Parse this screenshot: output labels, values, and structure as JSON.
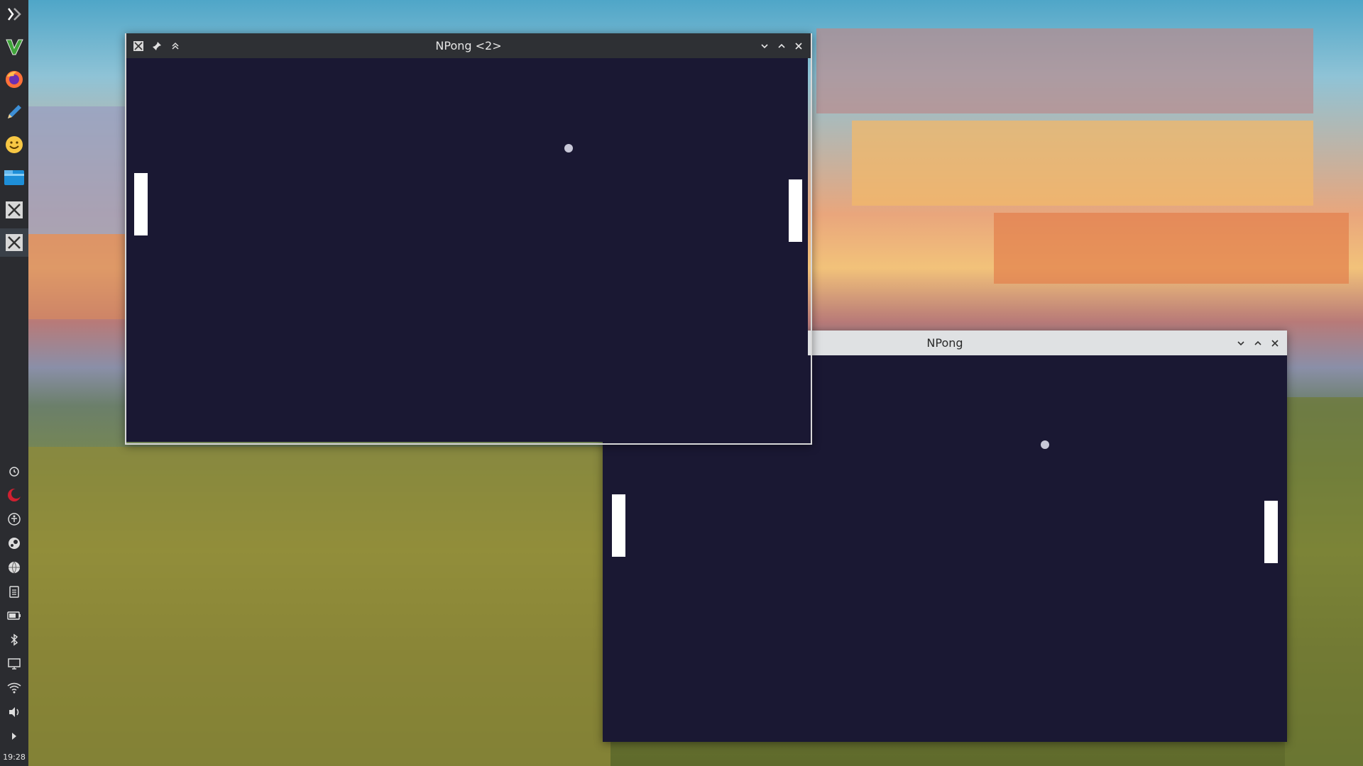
{
  "desktop": {
    "colors": {
      "panel": "#2b2c30",
      "game_bg": "#1a1833",
      "paddle": "#ffffff",
      "ball": "#c8c8d8"
    }
  },
  "taskbar": {
    "launchers": [
      {
        "name": "application-launcher-icon"
      },
      {
        "name": "vim-icon"
      },
      {
        "name": "firefox-icon"
      },
      {
        "name": "text-editor-icon"
      },
      {
        "name": "smiley-icon"
      },
      {
        "name": "file-manager-icon"
      },
      {
        "name": "x-window-icon"
      },
      {
        "name": "x-window-icon"
      }
    ],
    "tray": [
      {
        "name": "alarm-icon"
      },
      {
        "name": "night-mode-icon"
      },
      {
        "name": "accessibility-icon"
      },
      {
        "name": "steam-icon"
      },
      {
        "name": "globe-icon"
      },
      {
        "name": "clipboard-icon"
      },
      {
        "name": "battery-icon"
      },
      {
        "name": "bluetooth-icon"
      },
      {
        "name": "display-icon"
      },
      {
        "name": "wifi-icon"
      },
      {
        "name": "volume-icon"
      },
      {
        "name": "expand-tray-icon"
      }
    ],
    "clock": "19:28"
  },
  "window_front": {
    "title": "NPong <2>",
    "buttons": [
      "minimize",
      "maximize",
      "close"
    ]
  },
  "window_back": {
    "title": "NPong",
    "buttons": [
      "minimize",
      "maximize",
      "close"
    ]
  }
}
